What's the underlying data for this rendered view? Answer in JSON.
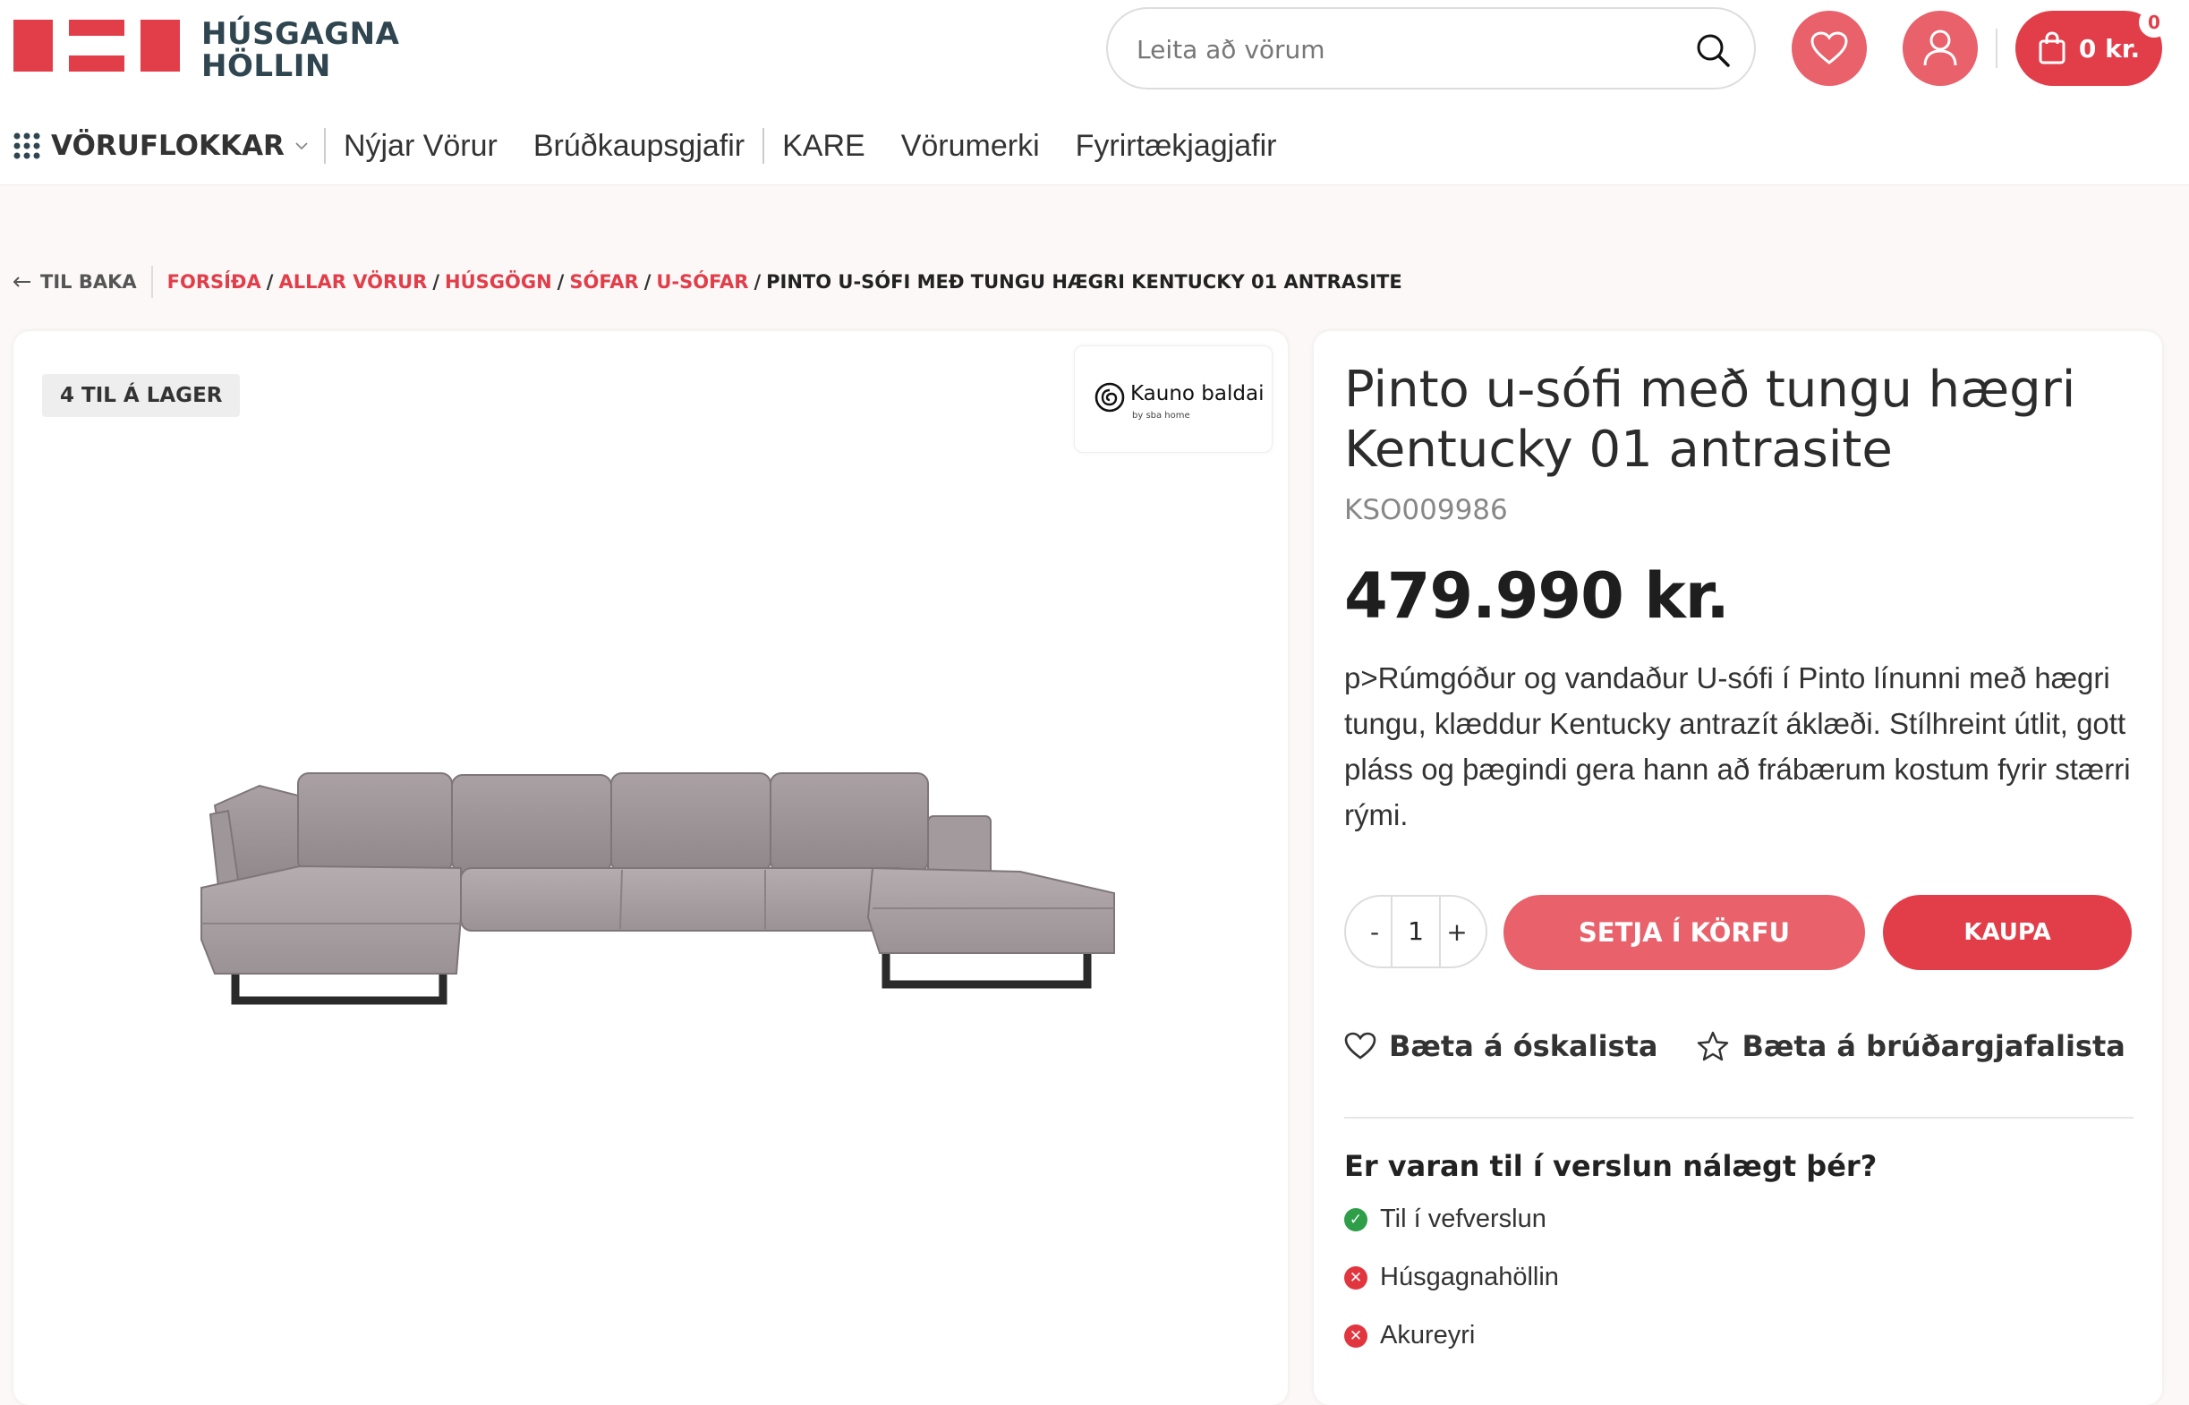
{
  "brand": {
    "logo_text": "HÚSGAGNA\nHÖLLIN",
    "accent": "#e23e4a",
    "dark_text": "#2f4550"
  },
  "header": {
    "search_placeholder": "Leita að vörum",
    "cart_total": "0 kr.",
    "cart_count": "0",
    "icons": [
      "search-icon",
      "heart-icon",
      "user-icon",
      "shopping-bag-icon"
    ]
  },
  "nav": {
    "categories_label": "VÖRUFLOKKAR",
    "items": [
      "Nýjar Vörur",
      "Brúðkaupsgjafir",
      "KARE",
      "Vörumerki",
      "Fyrirtækjagjafir"
    ]
  },
  "breadcrumb": {
    "back": "TIL BAKA",
    "links": [
      "FORSÍÐA",
      "ALLAR VÖRUR",
      "HÚSGÖGN",
      "SÓFAR",
      "U-SÓFAR"
    ],
    "current": "PINTO U-SÓFI MEÐ TUNGU HÆGRI KENTUCKY 01 ANTRASITE"
  },
  "gallery": {
    "stock_badge": "4 TIL Á LAGER",
    "brand_name": "Kauno baldai",
    "brand_sub": "by sba home"
  },
  "product": {
    "title": "Pinto u-sófi með tungu hægri Kentucky 01 antrasite",
    "sku": "KSO009986",
    "price": "479.990 kr.",
    "description": "p>Rúmgóður og vandaður U-sófi í Pinto línunni með hægri tungu, klæddur Kentucky antrazít áklæði. Stílhreint útlit, gott pláss og þægindi gera hann að frábærum kostum fyrir stærri rými.",
    "qty_minus": "-",
    "qty": "1",
    "qty_plus": "+",
    "add_to_cart": "SETJA Í KÖRFU",
    "buy": "KAUPA",
    "wishlist": "Bæta á óskalista",
    "wedding_list": "Bæta á brúðargjafalista"
  },
  "availability": {
    "title": "Er varan til í verslun nálægt þér?",
    "stores": [
      {
        "name": "Til í vefverslun",
        "status": "available"
      },
      {
        "name": "Húsgagnahöllin",
        "status": "unavailable"
      },
      {
        "name": "Akureyri",
        "status": "unavailable"
      }
    ]
  }
}
